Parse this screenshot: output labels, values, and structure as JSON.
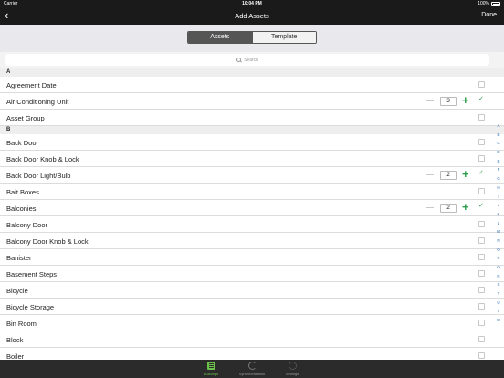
{
  "status": {
    "carrier": "Carrier",
    "time": "10:04 PM",
    "battery": "100%"
  },
  "nav": {
    "back_glyph": "‹",
    "title": "Add Assets",
    "done": "Done"
  },
  "segment": {
    "assets": "Assets",
    "template": "Template"
  },
  "search": {
    "placeholder": "Search"
  },
  "sections": [
    {
      "letter": "A",
      "items": [
        {
          "label": "Agreement Date",
          "checked": false
        },
        {
          "label": "Air Conditioning Unit",
          "checked": true,
          "quantity": "3"
        },
        {
          "label": "Asset Group",
          "checked": false
        }
      ]
    },
    {
      "letter": "B",
      "items": [
        {
          "label": "Back Door",
          "checked": false
        },
        {
          "label": "Back Door Knob & Lock",
          "checked": false
        },
        {
          "label": "Back Door Light/Bulb",
          "checked": true,
          "quantity": "2"
        },
        {
          "label": "Bait Boxes",
          "checked": false
        },
        {
          "label": "Balconies",
          "checked": true,
          "quantity": "2"
        },
        {
          "label": "Balcony Door",
          "checked": false
        },
        {
          "label": "Balcony Door Knob & Lock",
          "checked": false
        },
        {
          "label": "Banister",
          "checked": false
        },
        {
          "label": "Basement Steps",
          "checked": false
        },
        {
          "label": "Bicycle",
          "checked": false
        },
        {
          "label": "Bicycle Storage",
          "checked": false
        },
        {
          "label": "Bin Room",
          "checked": false
        },
        {
          "label": "Block",
          "checked": false
        },
        {
          "label": "Boiler",
          "checked": false
        }
      ]
    }
  ],
  "index_letters": [
    "A",
    "B",
    "C",
    "D",
    "E",
    "F",
    "G",
    "H",
    "I",
    "J",
    "K",
    "L",
    "M",
    "N",
    "O",
    "P",
    "Q",
    "R",
    "S",
    "T",
    "U",
    "V",
    "W"
  ],
  "tabs": {
    "buildings": "Buildings",
    "synchronisation": "Synchronisation",
    "settings": "Settings"
  },
  "colors": {
    "accent_green": "#2e9e4f",
    "tab_active": "#6cbf4a",
    "index_blue": "#2e6fb5",
    "bar_dark": "#1a1a1a"
  },
  "check_glyph": "✓",
  "plus_glyph": "+"
}
